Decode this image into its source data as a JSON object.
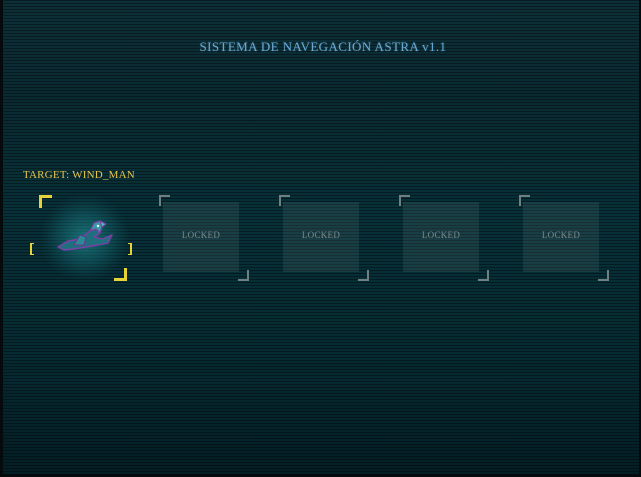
{
  "title": "SISTEMA DE NAVEGACIÓN ASTRA v1.1",
  "target": {
    "label": "TARGET: WIND_MAN",
    "icon": "wind-bird-icon"
  },
  "slots": [
    {
      "state": "selected",
      "icon": "wind-bird-icon"
    },
    {
      "state": "locked",
      "text": "LOCKED"
    },
    {
      "state": "locked",
      "text": "LOCKED"
    },
    {
      "state": "locked",
      "text": "LOCKED"
    },
    {
      "state": "locked",
      "text": "LOCKED"
    }
  ],
  "colors": {
    "title": "#69a8cf",
    "target_label": "#e6c64e",
    "selection": "#e8d23a",
    "locked_text": "#7d8b8d",
    "background": "#0a2a32"
  }
}
